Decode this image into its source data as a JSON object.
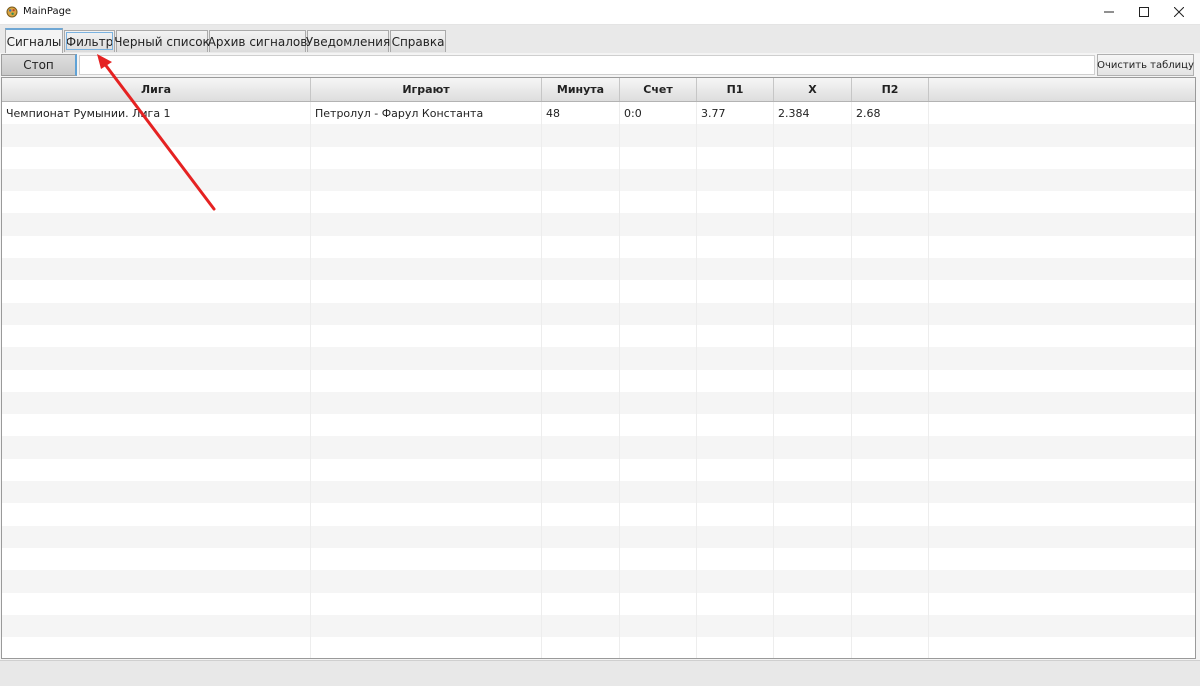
{
  "window": {
    "title": "MainPage"
  },
  "tabs": [
    {
      "label": "Сигналы",
      "active": true
    },
    {
      "label": "Фильтр",
      "active": false
    },
    {
      "label": "Черный список",
      "active": false
    },
    {
      "label": "Архив сигналов",
      "active": false
    },
    {
      "label": "Уведомления",
      "active": false
    },
    {
      "label": "Справка",
      "active": false
    }
  ],
  "toolbar": {
    "stop_label": "Стоп",
    "input_value": "",
    "clear_label": "Очистить таблицу"
  },
  "table": {
    "columns": [
      "Лига",
      "Играют",
      "Минута",
      "Счет",
      "П1",
      "X",
      "П2"
    ],
    "rows": [
      [
        "Чемпионат Румынии. Лига 1",
        "Петролул - Фарул Константа",
        "48",
        "0:0",
        "3.77",
        "2.384",
        "2.68"
      ]
    ]
  },
  "colors": {
    "annotation_arrow": "#e52222",
    "active_tab_accent": "#6fa7d4"
  },
  "icons": {
    "app": "app-icon",
    "minimize": "minimize-icon",
    "maximize": "maximize-icon",
    "close": "close-icon"
  }
}
